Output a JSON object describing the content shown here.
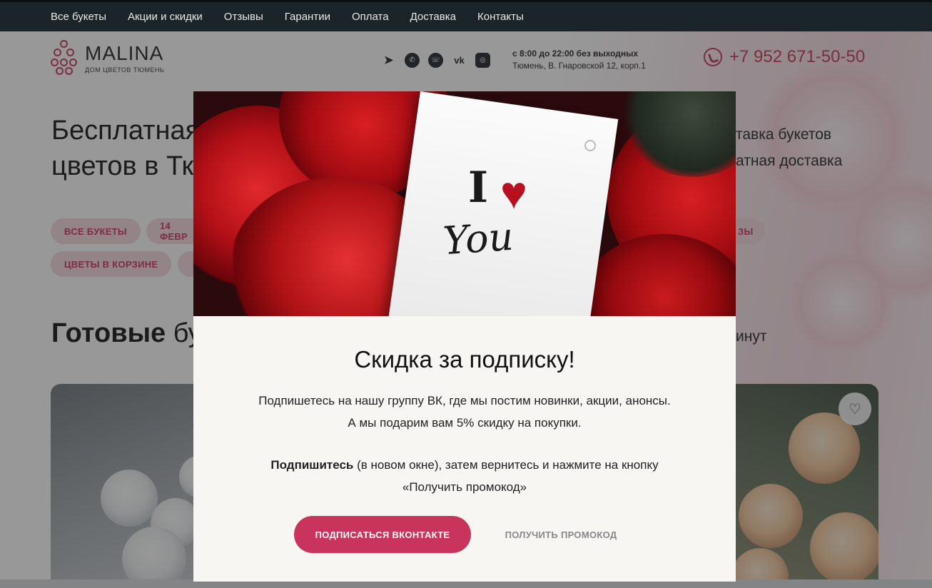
{
  "nav": {
    "items": [
      "Все букеты",
      "Акции и скидки",
      "Отзывы",
      "Гарантии",
      "Оплата",
      "Доставка",
      "Контакты"
    ]
  },
  "header": {
    "logo_title": "MALINA",
    "logo_subtitle": "ДОМ ЦВЕТОВ ТЮМЕНЬ",
    "socials": [
      "telegram-icon",
      "whatsapp-icon",
      "viber-icon",
      "vk-icon",
      "instagram-icon"
    ],
    "hours": "с 8:00 до 22:00 без выходных",
    "address": "Тюмень, В. Гнаровской 12, корп.1",
    "phone": "+7 952 671-50-50"
  },
  "hero": {
    "title_line1": "Бесплатная",
    "title_line2": "цветов в Тк",
    "right_line1": "тавка букетов",
    "right_line2": "атная доставка"
  },
  "chips": {
    "all_bouquets": "ВСЕ БУКЕТЫ",
    "feb14": "14 ФЕВР",
    "roses_partial": "ЗЫ",
    "in_basket": "ЦВЕТЫ В КОРЗИНЕ"
  },
  "section": {
    "title_bold": "Готовые",
    "title_rest": " бу",
    "right": "инут"
  },
  "modal": {
    "note_i": "I",
    "note_you": "You",
    "title": "Скидка за подписку!",
    "text_line1": "Подпишетесь на нашу группу ВК, где мы постим новинки, акции, анонсы.",
    "text_line2": "А мы подарим вам 5% скидку на покупки.",
    "text2_bold": "Подпишитесь",
    "text2_rest": " (в новом окне), затем вернитесь и нажмите на кнопку",
    "text2_line2": "«Получить промокод»",
    "subscribe_button": "ПОДПИСАТЬСЯ ВКОНТАКТЕ",
    "promo_button": "ПОЛУЧИТЬ ПРОМОКОД"
  },
  "colors": {
    "accent": "#c8345b",
    "nav_bg": "#1b2429",
    "chip_bg": "#f3d9df"
  }
}
